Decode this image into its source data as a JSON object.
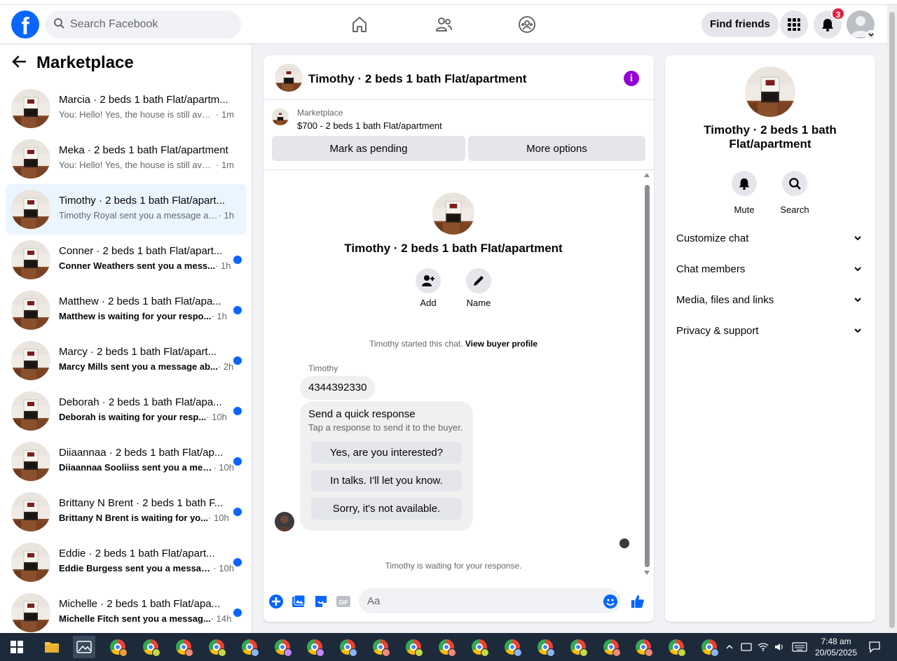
{
  "topbar": {
    "logo": "f",
    "search_placeholder": "Search Facebook",
    "nav_icons": [
      "home-icon",
      "friends-icon",
      "groups-icon"
    ],
    "find_friends": "Find friends",
    "notification_count": "3"
  },
  "sidebar": {
    "title": "Marketplace",
    "conversations": [
      {
        "title": "Marcia · 2 beds 1 bath Flat/apartm...",
        "snippet": "You: Hello! Yes, the house is still avail...",
        "time": "· 1m",
        "unread": false
      },
      {
        "title": "Meka · 2 beds 1 bath Flat/apartment",
        "snippet": "You: Hello! Yes, the house is still avail...",
        "time": "· 1m",
        "unread": false
      },
      {
        "title": "Timothy · 2 beds 1 bath Flat/apart...",
        "snippet": "Timothy Royal sent you a message ab...",
        "time": "· 1h",
        "unread": false,
        "active": true
      },
      {
        "title": "Conner · 2 beds 1 bath Flat/apart...",
        "snippet": "Conner Weathers sent you a mess...",
        "time": "· 1h",
        "unread": true
      },
      {
        "title": "Matthew · 2 beds 1 bath Flat/apa...",
        "snippet": "Matthew is waiting for your respo...",
        "time": "· 1h",
        "unread": true
      },
      {
        "title": "Marcy · 2 beds 1 bath Flat/apart...",
        "snippet": "Marcy Mills sent you a message ab...",
        "time": "· 2h",
        "unread": true
      },
      {
        "title": "Deborah · 2 beds 1 bath Flat/apa...",
        "snippet": "Deborah is waiting for your resp...",
        "time": "· 10h",
        "unread": true
      },
      {
        "title": "Diiaannaa · 2 beds 1 bath Flat/ap...",
        "snippet": "Diiaannaa Sooliiss sent you a mes...",
        "time": "· 10h",
        "unread": true
      },
      {
        "title": "Brittany N Brent · 2 beds 1 bath F...",
        "snippet": "Brittany N Brent is waiting for yo...",
        "time": "· 10h",
        "unread": true
      },
      {
        "title": "Eddie · 2 beds 1 bath Flat/apart...",
        "snippet": "Eddie Burgess sent you a messag...",
        "time": "· 10h",
        "unread": true
      },
      {
        "title": "Michelle · 2 beds 1 bath Flat/apa...",
        "snippet": "Michelle Fitch sent you a messag...",
        "time": "· 14h",
        "unread": true
      }
    ]
  },
  "chat": {
    "header_name": "Timothy · 2 beds 1 bath Flat/apartment",
    "marketplace_label": "Marketplace",
    "listing": "$700 - 2 beds 1 bath Flat/apartment",
    "mark_pending": "Mark as pending",
    "more_options": "More options",
    "center_name": "Timothy · 2 beds 1 bath Flat/apartment",
    "add_label": "Add",
    "name_label": "Name",
    "started_text": "Timothy started this chat. ",
    "view_profile": "View buyer profile",
    "sender": "Timothy",
    "message": "4344392330",
    "quick_title": "Send a quick response",
    "quick_sub": "Tap a response to send it to the buyer.",
    "quick_options": [
      "Yes, are you interested?",
      "In talks. I'll let you know.",
      "Sorry, it's not available."
    ],
    "waiting": "Timothy is waiting for your response.",
    "composer_placeholder": "Aa"
  },
  "details": {
    "name": "Timothy · 2 beds 1 bath Flat/apartment",
    "mute": "Mute",
    "search": "Search",
    "sections": [
      "Customize chat",
      "Chat members",
      "Media, files and links",
      "Privacy & support"
    ]
  },
  "taskbar": {
    "time": "7:48 am",
    "date": "20/05/2025"
  },
  "colors": {
    "brand": "#0866ff",
    "info": "#9400d3",
    "badge": "#e41e3f"
  }
}
